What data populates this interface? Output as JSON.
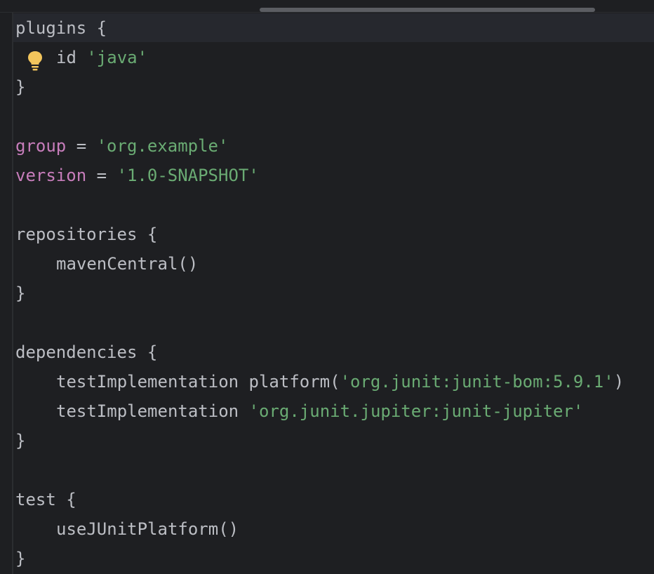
{
  "editor": {
    "lines": [
      {
        "parts": [
          {
            "t": "plugins",
            "c": "plain"
          },
          {
            "t": " {",
            "c": "brace"
          }
        ]
      },
      {
        "parts": [
          {
            "t": "id ",
            "c": "plain"
          },
          {
            "t": "'java'",
            "c": "str"
          }
        ],
        "lightbulb": true
      },
      {
        "parts": [
          {
            "t": "}",
            "c": "brace"
          }
        ]
      },
      {
        "parts": []
      },
      {
        "parts": [
          {
            "t": "group",
            "c": "kw"
          },
          {
            "t": " = ",
            "c": "plain"
          },
          {
            "t": "'org.example'",
            "c": "str"
          }
        ]
      },
      {
        "parts": [
          {
            "t": "version",
            "c": "kw"
          },
          {
            "t": " = ",
            "c": "plain"
          },
          {
            "t": "'1.0-SNAPSHOT'",
            "c": "str"
          }
        ]
      },
      {
        "parts": []
      },
      {
        "parts": [
          {
            "t": "repositories",
            "c": "plain"
          },
          {
            "t": " {",
            "c": "brace"
          }
        ]
      },
      {
        "indent": true,
        "parts": [
          {
            "t": "mavenCentral()",
            "c": "plain"
          }
        ]
      },
      {
        "parts": [
          {
            "t": "}",
            "c": "brace"
          }
        ]
      },
      {
        "parts": []
      },
      {
        "parts": [
          {
            "t": "dependencies",
            "c": "plain"
          },
          {
            "t": " {",
            "c": "brace"
          }
        ]
      },
      {
        "indent": true,
        "parts": [
          {
            "t": "testImplementation platform(",
            "c": "plain"
          },
          {
            "t": "'org.junit:junit-bom:5.9.1'",
            "c": "str"
          },
          {
            "t": ")",
            "c": "plain"
          }
        ]
      },
      {
        "indent": true,
        "parts": [
          {
            "t": "testImplementation ",
            "c": "plain"
          },
          {
            "t": "'org.junit.jupiter:junit-jupiter'",
            "c": "str"
          }
        ]
      },
      {
        "parts": [
          {
            "t": "}",
            "c": "brace"
          }
        ]
      },
      {
        "parts": []
      },
      {
        "parts": [
          {
            "t": "test",
            "c": "plain"
          },
          {
            "t": " {",
            "c": "brace"
          }
        ]
      },
      {
        "indent": true,
        "parts": [
          {
            "t": "useJUnitPlatform()",
            "c": "plain"
          }
        ]
      },
      {
        "parts": [
          {
            "t": "}",
            "c": "brace"
          }
        ]
      }
    ],
    "cursor_line": 0,
    "icons": {
      "intention": "lightbulb-icon"
    },
    "colors": {
      "background": "#1e1f22",
      "keyword": "#c77dbb",
      "string": "#6aab73",
      "text": "#bcbec4",
      "lightbulb": "#f2c55c"
    }
  }
}
